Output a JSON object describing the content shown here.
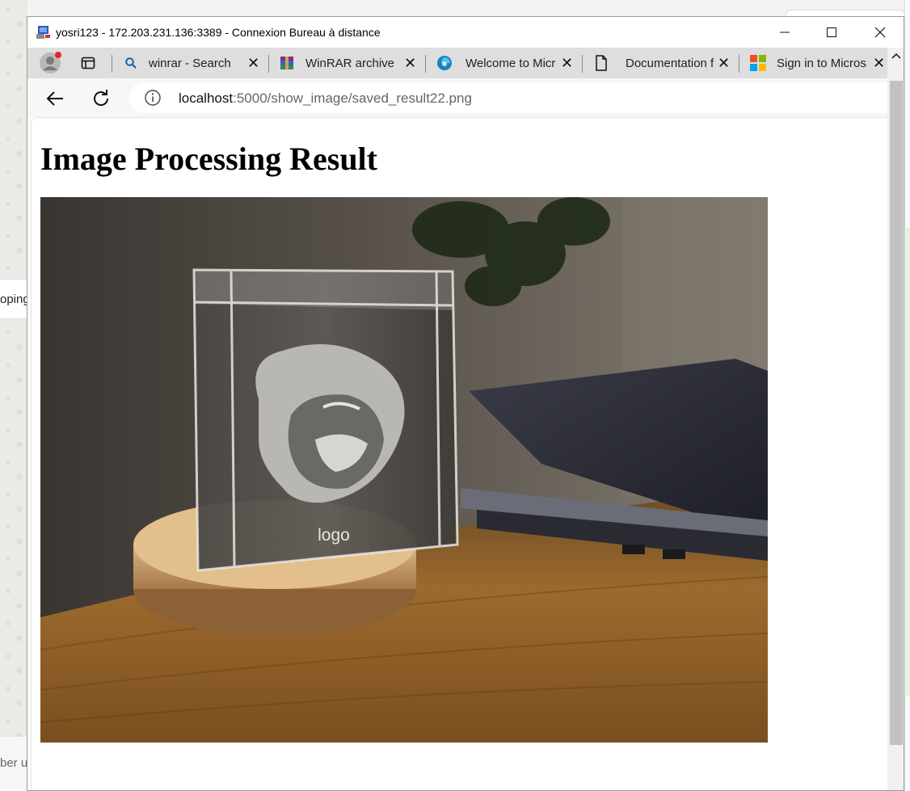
{
  "background": {
    "left_snippet_top": "oping",
    "left_snippet_bottom": "ber u"
  },
  "rdp": {
    "title": "yosri123 - 172.203.231.136:3389 - Connexion Bureau à distance"
  },
  "browser": {
    "tabs": [
      {
        "label": "winrar - Search",
        "icon": "search-icon"
      },
      {
        "label": "WinRAR archiver",
        "icon": "winrar-icon"
      },
      {
        "label": "Welcome to Micr",
        "icon": "edge-icon"
      },
      {
        "label": "Documentation f",
        "icon": "document-icon"
      },
      {
        "label": "Sign in to Micros",
        "icon": "microsoft-icon"
      }
    ],
    "url": {
      "host": "localhost",
      "path": ":5000/show_image/saved_result22.png"
    }
  },
  "page": {
    "title": "Image Processing Result",
    "image": {
      "engraving_label": "logo",
      "description_icon": "gorilla-logo-icon"
    }
  },
  "colors": {
    "tab_strip": "#dedede",
    "toolbar": "#f7f7f7",
    "accent_blue": "#1a73e8"
  }
}
